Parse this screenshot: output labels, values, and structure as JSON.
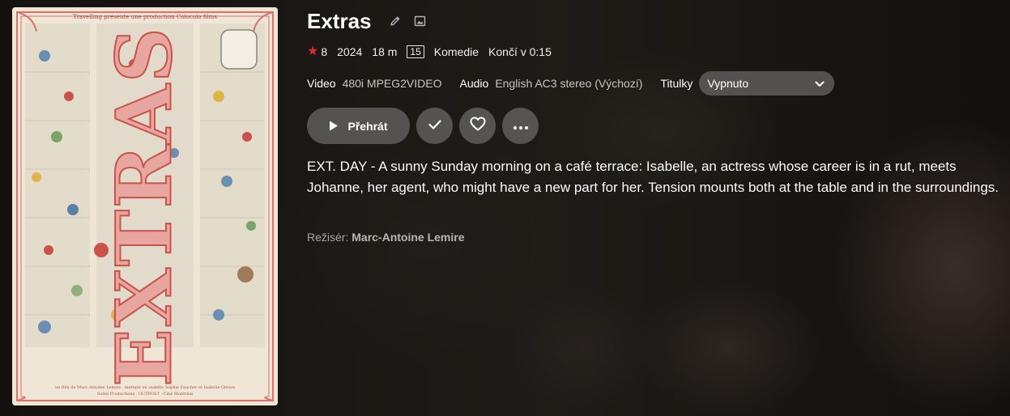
{
  "movie": {
    "title": "Extras",
    "rating": "8",
    "year": "2024",
    "runtime": "18 m",
    "age_rating": "15",
    "genre": "Komedie",
    "ends_at": "Končí v 0:15",
    "overview": "EXT. DAY - A sunny Sunday morning on a café terrace: Isabelle, an actress whose career is in a rut, meets Johanne, her agent, who might have a new part for her. Tension mounts both at the table and in the surroundings.",
    "director_label": "Režisér:",
    "director": "Marc-Antoine Lemire"
  },
  "media": {
    "video_label": "Video",
    "video_value": "480i MPEG2VIDEO",
    "audio_label": "Audio",
    "audio_value": "English AC3 stereo (Výchozí)",
    "subtitles_label": "Titulky",
    "subtitles_value": "Vypnuto"
  },
  "actions": {
    "play_label": "Přehrát"
  },
  "poster": {
    "big_title": "EXTRAS",
    "top_line": "Travelling présente une production Colocolo films",
    "credits_line_1": "un film de Marc-Antoine Lemire · mettant en vedette Sophie Faucher et Isabelle Giroux",
    "credits_line_2": "Soleil Productions · OUTPOST · Ciné Montréal"
  },
  "icons": {
    "edit": "pencil-icon",
    "image": "image-icon",
    "star": "star-icon",
    "play": "play-icon",
    "check": "check-icon",
    "heart": "heart-icon",
    "more": "more-dots-icon",
    "chevron": "chevron-down-icon"
  },
  "colors": {
    "star": "#e02a2a",
    "button_bg": "#5c5a58",
    "poster_bg": "#efe6d6",
    "poster_accent": "#c9524a"
  }
}
